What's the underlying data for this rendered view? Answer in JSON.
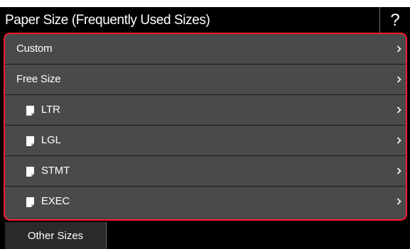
{
  "header": {
    "title": "Paper Size (Frequently Used Sizes)",
    "help_label": "?"
  },
  "list": {
    "items": [
      {
        "label": "Custom",
        "icon": null
      },
      {
        "label": "Free Size",
        "icon": null
      },
      {
        "label": "LTR",
        "icon": "paper-sheet-icon"
      },
      {
        "label": "LGL",
        "icon": "paper-sheet-icon"
      },
      {
        "label": "STMT",
        "icon": "paper-sheet-icon"
      },
      {
        "label": "EXEC",
        "icon": "paper-sheet-icon"
      }
    ],
    "chevron_icon": "chevron-right-icon"
  },
  "footer": {
    "other_sizes_label": "Other Sizes"
  },
  "colors": {
    "background": "#000000",
    "list_item": "#4a4a4a",
    "selection_border": "#ff1a2b",
    "text": "#ffffff"
  }
}
